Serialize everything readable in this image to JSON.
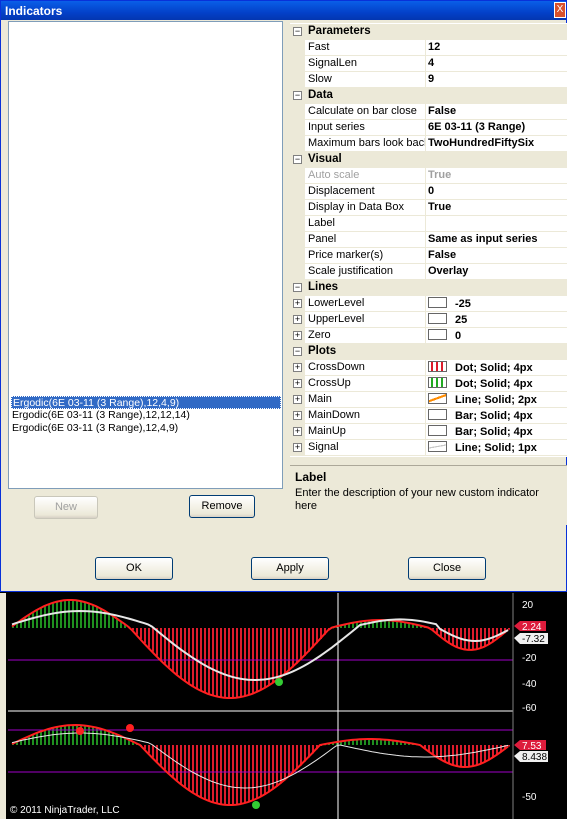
{
  "window": {
    "title": "Indicators",
    "close_glyph": "X"
  },
  "indicator_list": [
    "Ergodic(6E 03-11 (3 Range),12,4,9)",
    "Ergodic(6E 03-11 (3 Range),12,12,14)",
    "Ergodic(6E 03-11 (3 Range),12,4,9)"
  ],
  "buttons": {
    "new": "New",
    "remove": "Remove",
    "ok": "OK",
    "apply": "Apply",
    "close": "Close"
  },
  "grid": {
    "categories": {
      "parameters": "Parameters",
      "data": "Data",
      "visual": "Visual",
      "lines": "Lines",
      "plots": "Plots"
    },
    "parameters": [
      {
        "name": "Fast",
        "value": "12"
      },
      {
        "name": "SignalLen",
        "value": "4"
      },
      {
        "name": "Slow",
        "value": "9"
      }
    ],
    "data": [
      {
        "name": "Calculate on bar close",
        "value": "False"
      },
      {
        "name": "Input series",
        "value": "6E 03-11 (3 Range)"
      },
      {
        "name": "Maximum bars look back",
        "value": "TwoHundredFiftySix"
      }
    ],
    "visual": [
      {
        "name": "Auto scale",
        "value": "True"
      },
      {
        "name": "Displacement",
        "value": "0"
      },
      {
        "name": "Display in Data Box",
        "value": "True"
      },
      {
        "name": "Label",
        "value": ""
      },
      {
        "name": "Panel",
        "value": "Same as input series"
      },
      {
        "name": "Price marker(s)",
        "value": "False"
      },
      {
        "name": "Scale justification",
        "value": "Overlay"
      }
    ],
    "lines": [
      {
        "name": "LowerLevel",
        "value": "-25"
      },
      {
        "name": "UpperLevel",
        "value": "25"
      },
      {
        "name": "Zero",
        "value": "0"
      }
    ],
    "plots": [
      {
        "name": "CrossDown",
        "value": "Dot; Solid; 4px",
        "icon": "red-bars-icon"
      },
      {
        "name": "CrossUp",
        "value": "Dot; Solid; 4px",
        "icon": "green-bars-icon"
      },
      {
        "name": "Main",
        "value": "Line; Solid; 2px",
        "icon": "orange-line-icon"
      },
      {
        "name": "MainDown",
        "value": "Bar; Solid; 4px",
        "icon": "blank-swatch-icon"
      },
      {
        "name": "MainUp",
        "value": "Bar; Solid; 4px",
        "icon": "blank-swatch-icon"
      },
      {
        "name": "Signal",
        "value": "Line; Solid; 1px",
        "icon": "gray-line-icon"
      }
    ]
  },
  "description": {
    "title": "Label",
    "text": "Enter the description of your new custom indicator here"
  },
  "chart": {
    "copyright": "© 2011 NinjaTrader, LLC",
    "upper_axis_ticks": [
      "20",
      "-20",
      "-40",
      "-60"
    ],
    "upper_markers": [
      "2.24",
      "-7.32"
    ],
    "lower_axis_ticks": [
      "-50"
    ],
    "lower_markers": [
      "7.53",
      "8.438"
    ]
  },
  "colors": {
    "title_bar": "#0341c9",
    "selection": "#316ac5",
    "up_bars": "#228b22",
    "down_bars": "#dd1c2c",
    "signal_line": "#e6e6e6",
    "level_lines": "#a000c8"
  }
}
